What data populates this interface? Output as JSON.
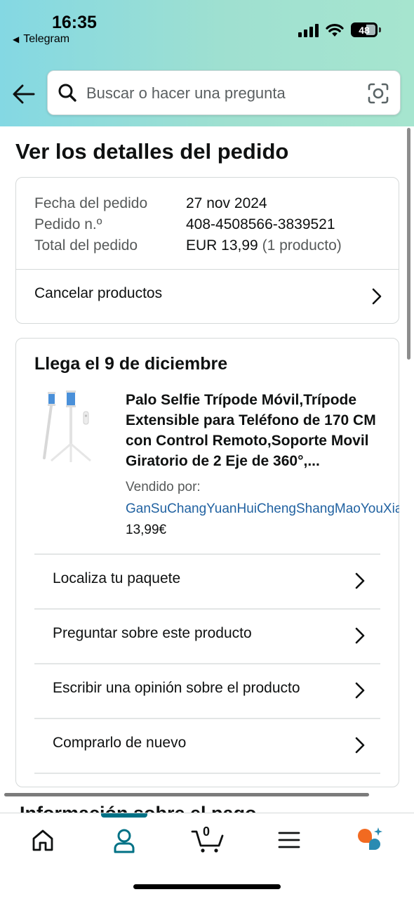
{
  "status_bar": {
    "time": "16:35",
    "back_app": "Telegram",
    "battery": "48",
    "icons": [
      "cellular-signal-icon",
      "wifi-icon",
      "battery-icon"
    ]
  },
  "search": {
    "placeholder": "Buscar o hacer una pregunta",
    "icons": [
      "back-arrow-icon",
      "search-icon",
      "camera-scan-icon"
    ]
  },
  "page": {
    "title": "Ver los detalles del pedido"
  },
  "order_summary": {
    "rows": [
      {
        "key": "Fecha del pedido",
        "value": "27 nov 2024"
      },
      {
        "key": "Pedido n.º",
        "value": "408-4508566-3839521"
      },
      {
        "key": "Total del pedido",
        "value": "EUR 13,99",
        "extra": "(1 producto)"
      }
    ],
    "cancel_label": "Cancelar productos"
  },
  "delivery": {
    "title": "Llega el 9 de diciembre",
    "product": {
      "name": "Palo Selfie Trípode Móvil,Trípode Extensible para Teléfono de 170 CM con Control Remoto,Soporte Movil Giratorio de 2 Eje de 360°,...",
      "sold_by_label": "Vendido por:",
      "seller": "GanSuChangYuanHuiChengShangMaoYouXianGongSi",
      "price": "13,99€"
    },
    "actions": [
      {
        "label": "Localiza tu paquete"
      },
      {
        "label": "Preguntar sobre este producto"
      },
      {
        "label": "Escribir una opinión sobre el producto"
      },
      {
        "label": "Comprarlo de nuevo"
      }
    ]
  },
  "next_section": {
    "title": "Información sobre el pago"
  },
  "tabbar": {
    "cart_count": "0",
    "active_tab": "account",
    "accent_color": "#007185",
    "icons": [
      "home-icon",
      "account-icon",
      "cart-icon",
      "menu-icon",
      "rufus-ai-icon"
    ]
  }
}
